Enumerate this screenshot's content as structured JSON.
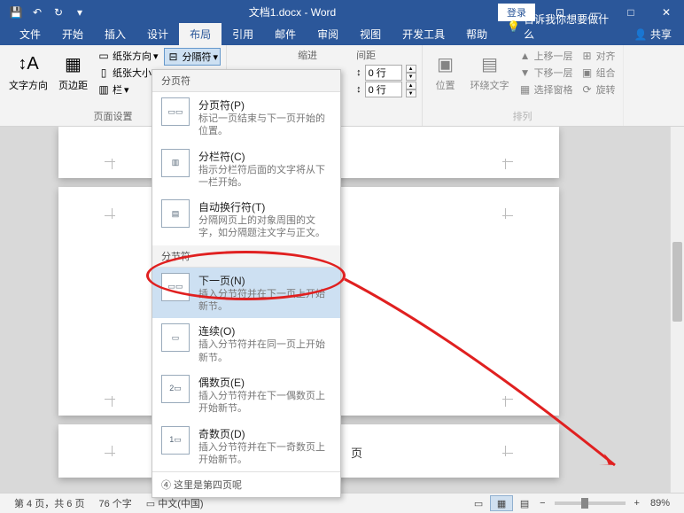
{
  "titlebar": {
    "doc_title": "文档1.docx - Word",
    "login": "登录"
  },
  "tabs": {
    "file": "文件",
    "home": "开始",
    "insert": "插入",
    "design": "设计",
    "layout": "布局",
    "references": "引用",
    "mailings": "邮件",
    "review": "审阅",
    "view": "视图",
    "developer": "开发工具",
    "help": "帮助",
    "tell_me": "告诉我你想要做什么",
    "share": "共享"
  },
  "ribbon": {
    "text_direction": "文字方向",
    "margins": "页边距",
    "orientation": "纸张方向",
    "size": "纸张大小",
    "columns": "栏",
    "breaks": "分隔符",
    "page_setup": "页面设置",
    "indent_header": "缩进",
    "spacing_header": "间距",
    "spacing_before_val": "0 行",
    "spacing_after_val": "0 行",
    "position": "位置",
    "wrap": "环绕文字",
    "forward": "上移一层",
    "backward": "下移一层",
    "selection_pane": "选择窗格",
    "align": "对齐",
    "group": "组合",
    "rotate": "旋转",
    "arrange": "排列"
  },
  "dropdown": {
    "section_page_breaks": "分页符",
    "section_section_breaks": "分节符",
    "items": [
      {
        "title": "分页符(P)",
        "desc": "标记一页结束与下一页开始的位置。"
      },
      {
        "title": "分栏符(C)",
        "desc": "指示分栏符后面的文字将从下一栏开始。"
      },
      {
        "title": "自动换行符(T)",
        "desc": "分隔网页上的对象周围的文字，如分隔题注文字与正文。"
      },
      {
        "title": "下一页(N)",
        "desc": "插入分节符并在下一页上开始新节。"
      },
      {
        "title": "连续(O)",
        "desc": "插入分节符并在同一页上开始新节。"
      },
      {
        "title": "偶数页(E)",
        "desc": "插入分节符并在下一偶数页上开始新节。"
      },
      {
        "title": "奇数页(D)",
        "desc": "插入分节符并在下一奇数页上开始新节。"
      }
    ],
    "footer": "④  这里是第四页呢"
  },
  "document": {
    "page3_text": "页"
  },
  "statusbar": {
    "page_info": "第 4 页，共 6 页",
    "word_count": "76 个字",
    "language": "中文(中国)",
    "zoom": "89%"
  },
  "icons": {
    "save": "💾",
    "undo": "↶",
    "redo": "↻",
    "dropdown": "▾",
    "ribbon_opts": "⊡",
    "minimize": "—",
    "maximize": "□",
    "close": "✕",
    "bulb": "💡",
    "person": "👤"
  }
}
